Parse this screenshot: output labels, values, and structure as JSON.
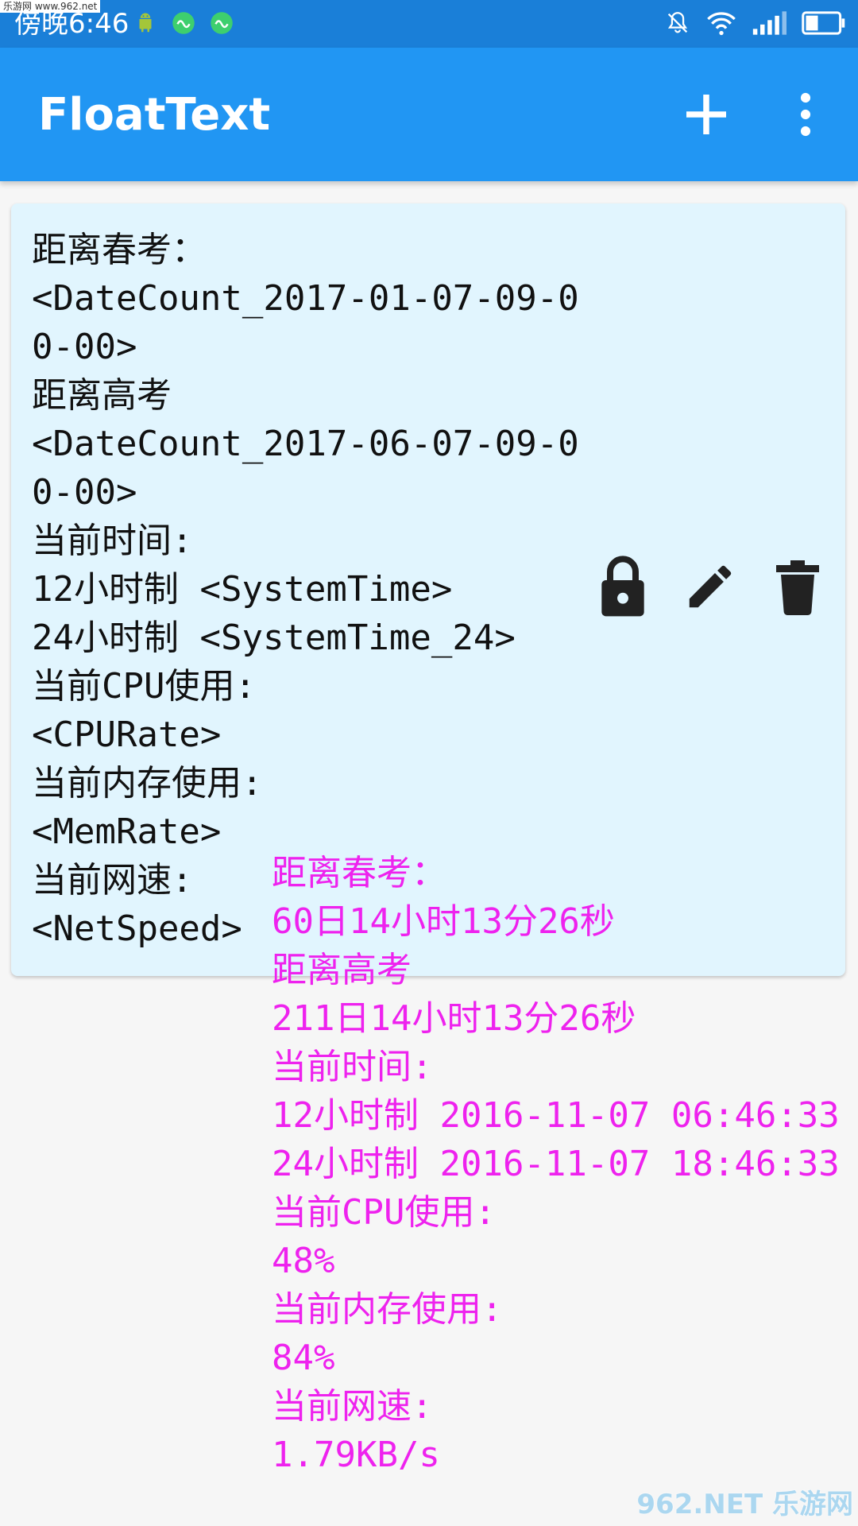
{
  "status_bar": {
    "time": "傍晚6:46",
    "watermark": "乐游网 www.962.net",
    "icons": [
      "android-icon",
      "app-icon",
      "app-icon",
      "silent-bell-icon",
      "wifi-icon",
      "signal-icon",
      "battery-icon"
    ],
    "colors": {
      "bg": "#1a7fd8"
    }
  },
  "app_bar": {
    "title": "FloatText",
    "add_icon": "plus-icon",
    "menu_icon": "more-vert-icon",
    "colors": {
      "bg": "#2196f3"
    }
  },
  "card": {
    "template_text": "距离春考：\n<DateCount_2017-01-07-09-00-00>\n距离高考\n<DateCount_2017-06-07-09-00-00>\n当前时间:\n12小时制 <SystemTime>\n24小时制 <SystemTime_24>\n当前CPU使用:\n<CPURate>\n当前内存使用:\n<MemRate>\n当前网速:\n<NetSpeed>",
    "actions": [
      "lock-icon",
      "edit-icon",
      "delete-icon"
    ],
    "colors": {
      "bg": "#e1f5fe"
    }
  },
  "float_overlay": {
    "text": "距离春考：\n60日14小时13分26秒\n距离高考\n211日14小时13分26秒\n当前时间:\n12小时制 2016-11-07 06:46:33\n24小时制 2016-11-07 18:46:33\n当前CPU使用:\n48%\n当前内存使用:\n84%\n当前网速:\n1.79KB/s",
    "colors": {
      "text": "#ee22ee"
    }
  },
  "watermark_bottom": "962.NET 乐游网"
}
